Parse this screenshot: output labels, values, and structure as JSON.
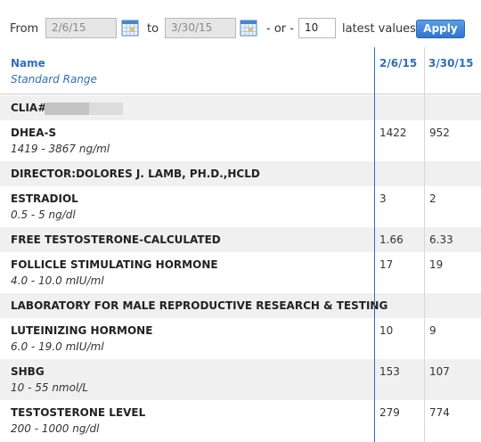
{
  "filter": {
    "from_label": "From",
    "from_value": "2/6/15",
    "to_label": "to",
    "to_value": "3/30/15",
    "or_label": "- or -",
    "count_value": "10",
    "latest_label": "latest values",
    "apply_label": "Apply"
  },
  "table": {
    "header_name": "Name",
    "header_range": "Standard Range",
    "columns": [
      "2/6/15",
      "3/30/15"
    ],
    "rows": [
      {
        "name": "CLIA#",
        "range": "",
        "v1": "",
        "v2": ""
      },
      {
        "name": "DHEA-S",
        "range": "1419 - 3867 ng/ml",
        "v1": "1422",
        "v2": "952"
      },
      {
        "name": "DIRECTOR:DOLORES J. LAMB, PH.D.,HCLD",
        "range": "",
        "v1": "",
        "v2": ""
      },
      {
        "name": "ESTRADIOL",
        "range": "0.5 - 5 ng/dl",
        "v1": "3",
        "v2": "2"
      },
      {
        "name": "FREE TESTOSTERONE-CALCULATED",
        "range": "",
        "v1": "1.66",
        "v2": "6.33"
      },
      {
        "name": "FOLLICLE STIMULATING HORMONE",
        "range": "4.0 - 10.0 mIU/ml",
        "v1": "17",
        "v2": "19"
      },
      {
        "name": "LABORATORY FOR MALE REPRODUCTIVE RESEARCH & TESTING",
        "range": "",
        "v1": "",
        "v2": ""
      },
      {
        "name": "LUTEINIZING HORMONE",
        "range": "6.0 - 19.0 mIU/ml",
        "v1": "10",
        "v2": "9"
      },
      {
        "name": "SHBG",
        "range": "10 - 55 nmol/L",
        "v1": "153",
        "v2": "107"
      },
      {
        "name": "TESTOSTERONE LEVEL",
        "range": "200 - 1000 ng/dl",
        "v1": "279",
        "v2": "774"
      }
    ]
  },
  "colors": {
    "accent": "#2f6fb8",
    "alt_row": "#f0f0f0"
  }
}
